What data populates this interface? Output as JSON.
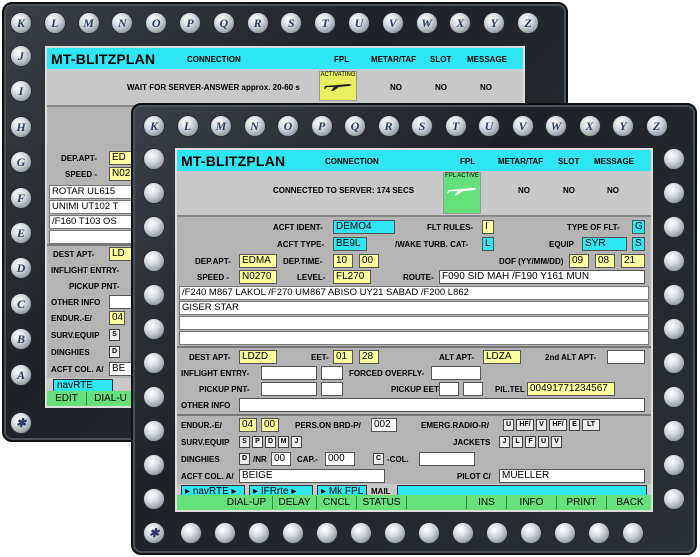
{
  "keys": {
    "letters": [
      "K",
      "L",
      "M",
      "N",
      "O",
      "P",
      "Q",
      "R",
      "S",
      "T",
      "U",
      "V",
      "W",
      "X",
      "Y",
      "Z"
    ],
    "left_column": [
      "J",
      "I",
      "H",
      "G",
      "F",
      "E",
      "D",
      "C",
      "B",
      "A"
    ],
    "bottom_star": "✱"
  },
  "back": {
    "title": "MT-BLITZPLAN",
    "headers": {
      "connection": "CONNECTION",
      "fpl": "FPL",
      "metar": "METAR/TAF",
      "slot": "SLOT",
      "message": "MESSAGE"
    },
    "status_text": "WAIT FOR SERVER-ANSWER approx. 20-60 s",
    "fpl_state": "ACTIVATING",
    "metar_val": "NO",
    "slot_val": "NO",
    "message_val": "NO",
    "labels": {
      "dep_apt": "DEP.APT-",
      "speed": "SPEED -",
      "dest_apt": "DEST APT-",
      "inflight": "INFLIGHT ENTRY-",
      "pickup": "PICKUP PNT-",
      "other": "OTHER INFO",
      "endur": "ENDUR.-E/",
      "surv": "SURV.EQUIP",
      "dinghies": "DINGHIES",
      "acft_col": "ACFT COL. A/"
    },
    "values": {
      "dep_apt": "ED",
      "speed": "N02",
      "dest_apt": "LD",
      "endur": "04",
      "surv": "S",
      "dinghies": "D",
      "acft_col": "BE"
    },
    "route_lines": [
      "ROTAR UL615",
      "UNIMI UT102 T",
      "/F160 T103 OS"
    ],
    "nav_button": "navRTE",
    "soft": [
      "EDIT",
      "DIAL-U"
    ]
  },
  "front": {
    "title": "MT-BLITZPLAN",
    "headers": {
      "connection": "CONNECTION",
      "fpl": "FPL",
      "metar": "METAR/TAF",
      "slot": "SLOT",
      "message": "MESSAGE"
    },
    "status_text": "CONNECTED TO SERVER: 174 SECS",
    "fpl_state": "FPL ACTIVE",
    "metar_val": "NO",
    "slot_val": "NO",
    "message_val": "NO",
    "labels": {
      "acft_ident": "ACFT IDENT-",
      "flt_rules": "FLT RULES-",
      "type_of_flt": "TYPE OF FLT-",
      "acft_type": "ACFT TYPE-",
      "wake": "/WAKE TURB. CAT-",
      "equip": "EQUIP",
      "dep_apt": "DEP.APT-",
      "dep_time": "DEP.TIME-",
      "dof": "DOF (YY/MM/DD)",
      "speed": "SPEED -",
      "level": "LEVEL-",
      "route": "ROUTE-",
      "dest_apt": "DEST APT-",
      "eet": "EET-",
      "alt_apt": "ALT APT-",
      "alt2": "2nd ALT APT-",
      "inflight": "INFLIGHT ENTRY-",
      "forced": "FORCED OVERFLY-",
      "pickup": "PICKUP PNT-",
      "pickup_eet": "PICKUP EET-",
      "pil_tel": "PIL.TEL",
      "other": "OTHER INFO",
      "endur": "ENDUR.-E/",
      "pers": "PERS.ON BRD-P/",
      "emerg": "EMERG.RADIO-R/",
      "surv": "SURV.EQUIP",
      "jackets": "JACKETS",
      "dinghies": "DINGHIES",
      "nr": "/NR",
      "cap": "CAP.-",
      "col": "-COL.",
      "acft_col": "ACFT COL. A/",
      "pilot": "PILOT C/"
    },
    "values": {
      "acft_ident": "DEMO4",
      "flt_rules": "I",
      "type_of_flt": "G",
      "acft_type": "BE9L",
      "wake": "L",
      "equip": "SYR",
      "equip2": "S",
      "dep_apt": "EDMA",
      "dep_h": "10",
      "dep_m": "00",
      "dof_y": "09",
      "dof_m": "08",
      "dof_d": "21",
      "speed": "N0270",
      "level": "FL270",
      "route": "F090 SID MAH /F190 Y161 MUN",
      "dest_apt": "LDZD",
      "eet_h": "01",
      "eet_m": "28",
      "alt_apt": "LDZA",
      "pil_tel": "00491771234567",
      "endur_h": "04",
      "endur_m": "00",
      "pers": "002",
      "dinghy_d": "D",
      "dinghy_nr": "00",
      "cap": "000",
      "col_c": "C",
      "acft_col": "BEIGE",
      "pilot": "MUELLER"
    },
    "route_lines": [
      "/F240 M867 LAKOL /F270 UM867 ABISO UY21 SABAD /F200 L862",
      "GISER STAR"
    ],
    "emerg_boxes": [
      "U",
      "HF/",
      "V",
      "HF/",
      "E",
      "LT"
    ],
    "surv_boxes": [
      "S",
      "P",
      "D",
      "M",
      "J"
    ],
    "jacket_boxes": [
      "J",
      "L",
      "F",
      "U",
      "V"
    ],
    "nav": {
      "b1": "navRTE",
      "b2": "IFRrte",
      "b3": "Mk FPL",
      "mail": "MAIL"
    },
    "soft": [
      "DIAL-UP",
      "DELAY",
      "CNCL",
      "STATUS",
      "",
      "INS",
      "INFO",
      "PRINT",
      "BACK"
    ]
  }
}
